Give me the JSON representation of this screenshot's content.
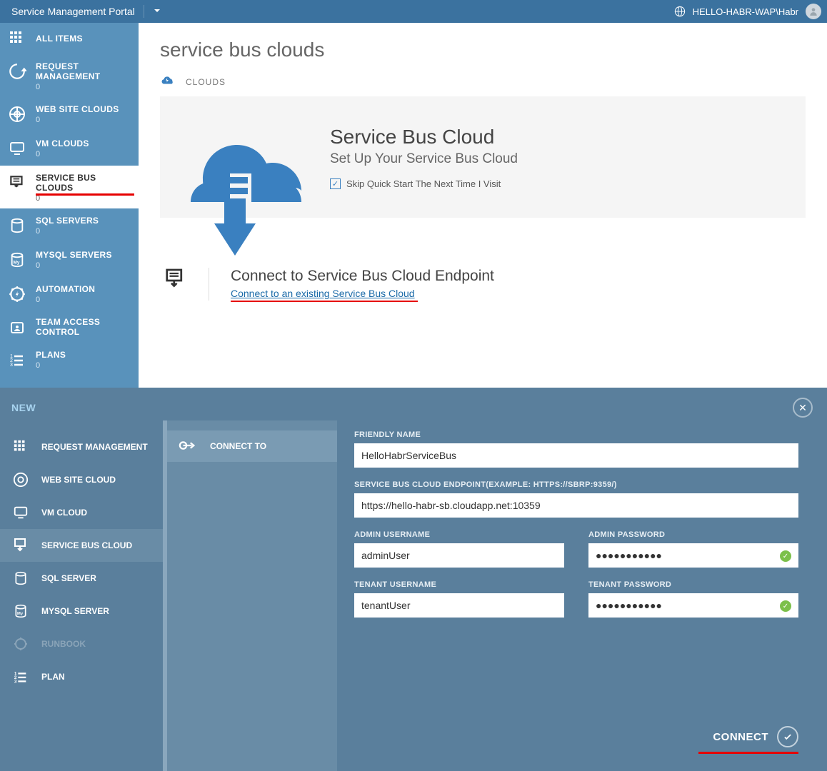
{
  "header": {
    "title": "Service Management Portal",
    "user": "HELLO-HABR-WAP\\Habr"
  },
  "sidebar": {
    "items": [
      {
        "label": "ALL ITEMS",
        "count": null
      },
      {
        "label": "REQUEST MANAGEMENT",
        "count": "0"
      },
      {
        "label": "WEB SITE CLOUDS",
        "count": "0"
      },
      {
        "label": "VM CLOUDS",
        "count": "0"
      },
      {
        "label": "SERVICE BUS CLOUDS",
        "count": "0"
      },
      {
        "label": "SQL SERVERS",
        "count": "0"
      },
      {
        "label": "MYSQL SERVERS",
        "count": "0"
      },
      {
        "label": "AUTOMATION",
        "count": "0"
      },
      {
        "label": "TEAM ACCESS CONTROL",
        "count": null
      },
      {
        "label": "PLANS",
        "count": "0"
      }
    ]
  },
  "main": {
    "page_title": "service bus clouds",
    "tab_label": "CLOUDS",
    "hero": {
      "title": "Service Bus Cloud",
      "subtitle": "Set Up Your Service Bus Cloud",
      "checkbox_label": "Skip Quick Start The Next Time I Visit"
    },
    "connect_section": {
      "title": "Connect to Service Bus Cloud Endpoint",
      "link": "Connect to an existing Service Bus Cloud"
    }
  },
  "drawer": {
    "new_label": "NEW",
    "col1": [
      {
        "label": "REQUEST MANAGEMENT"
      },
      {
        "label": "WEB SITE CLOUD"
      },
      {
        "label": "VM CLOUD"
      },
      {
        "label": "SERVICE BUS CLOUD"
      },
      {
        "label": "SQL SERVER"
      },
      {
        "label": "MYSQL SERVER"
      },
      {
        "label": "RUNBOOK"
      },
      {
        "label": "PLAN"
      }
    ],
    "col2": {
      "connect_to": "CONNECT TO"
    },
    "form": {
      "friendly_name_label": "FRIENDLY NAME",
      "friendly_name_value": "HelloHabrServiceBus",
      "endpoint_label": "SERVICE BUS CLOUD ENDPOINT(EXAMPLE: HTTPS://SBRP:9359/)",
      "endpoint_value": "https://hello-habr-sb.cloudapp.net:10359",
      "admin_user_label": "ADMIN USERNAME",
      "admin_user_value": "adminUser",
      "admin_pass_label": "ADMIN PASSWORD",
      "admin_pass_value": "●●●●●●●●●●●",
      "tenant_user_label": "TENANT USERNAME",
      "tenant_user_value": "tenantUser",
      "tenant_pass_label": "TENANT PASSWORD",
      "tenant_pass_value": "●●●●●●●●●●●"
    },
    "connect_button": "CONNECT"
  }
}
